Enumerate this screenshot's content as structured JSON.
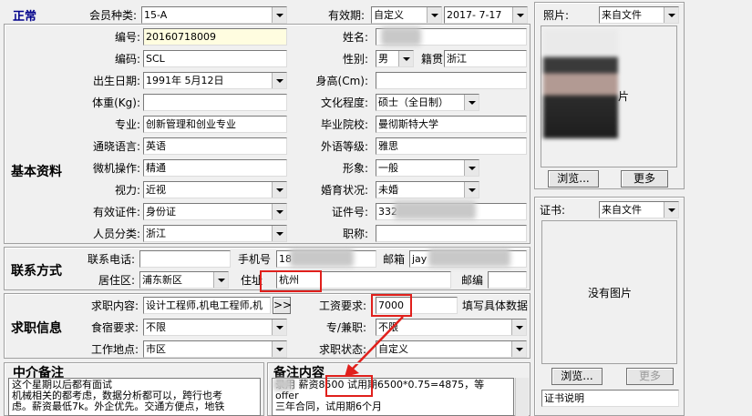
{
  "status": "正常",
  "sections": {
    "basic": "基本资料",
    "contact": "联系方式",
    "job": "求职信息",
    "agent_note": "中介备注",
    "remark": "备注内容"
  },
  "labels": {
    "member_type": "会员种类:",
    "valid_period": "有效期:",
    "number": "编号:",
    "name": "姓名:",
    "code": "编码:",
    "gender": "性别:",
    "birth": "出生日期:",
    "height": "身高(Cm):",
    "weight": "体重(Kg):",
    "education": "文化程度:",
    "major": "专业:",
    "school": "毕业院校:",
    "common_lang": "通晓语言:",
    "foreign_level": "外语等级:",
    "computer": "微机操作:",
    "image": "形象:",
    "eyesight": "视力:",
    "marital": "婚育状况:",
    "id_type": "有效证件:",
    "id_no": "证件号:",
    "person_class": "人员分类:",
    "title": "职称:",
    "phone": "联系电话:",
    "mobile": "手机号",
    "email": "邮箱",
    "district": "居住区:",
    "address": "住址",
    "postcode": "邮编",
    "job_content": "求职内容:",
    "salary_req": "工资要求:",
    "salary_hint": "填写具体数据",
    "food_req": "食宿要求:",
    "full_part": "专/兼职:",
    "work_place": "工作地点:",
    "job_status": "求职状态:",
    "native": "籍贯",
    "photo": "照片:",
    "cert": "证书:"
  },
  "values": {
    "member_type": "15-A",
    "valid_type": "自定义",
    "valid_date": "2017- 7-17",
    "number": "20160718009",
    "code": "SCL",
    "gender": "男",
    "native": "浙江",
    "birth": "1991年 5月12日",
    "education": "硕士（全日制）",
    "major": "创新管理和创业专业",
    "school": "曼彻斯特大学",
    "common_lang": "英语",
    "foreign_level": "雅思",
    "computer": "精通",
    "image": "一般",
    "eyesight": "近视",
    "marital": "未婚",
    "id_type": "身份证",
    "id_no": "332",
    "person_class": "浙江",
    "mobile": "18",
    "email": "jay",
    "district": "浦东新区",
    "address": "杭州",
    "job_content": "设计工程师,机电工程师,机",
    "salary": "7000",
    "food_req": "不限",
    "full_part": "不限",
    "work_place": "市区",
    "job_status": "自定义",
    "photo_source": "来自文件",
    "cert_source": "来自文件",
    "cert_desc": "证书说明"
  },
  "buttons": {
    "browse": "浏览...",
    "more": "更多",
    "browse2": "浏览...",
    "more2": "更多",
    "expand": ">>"
  },
  "photo_text": "片",
  "no_image": "没有图片",
  "agent_note_text": "这个星期以后都有面试\n机械相关的都考虑，数据分析都可以，跨行也考\n虑。薪资最低7k。外企优先。交通方便点，地铁",
  "remark_text": "录用 薪资8500 试用期6500*0.75=4875，等\noffer\n三年合同，试用期6个月",
  "colors": {
    "status": "#00008b",
    "highlight": "#e0201c"
  }
}
